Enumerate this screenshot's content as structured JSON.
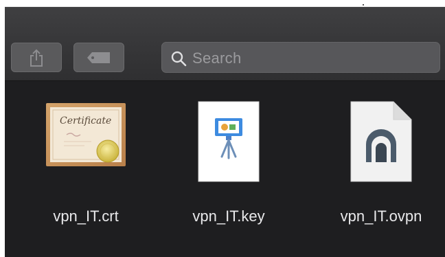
{
  "toolbar": {
    "share_icon": "share-icon",
    "tag_icon": "tag-icon"
  },
  "search": {
    "placeholder": "Search",
    "icon": "magnifier-icon"
  },
  "files": [
    {
      "name": "vpn_IT.crt",
      "icon": "certificate-icon"
    },
    {
      "name": "vpn_IT.key",
      "icon": "keynote-document-icon"
    },
    {
      "name": "vpn_IT.ovpn",
      "icon": "tunnel-document-icon"
    }
  ],
  "certificate_text": "Certificate",
  "colors": {
    "window_bg": "#1e1e20",
    "toolbar": "#3a3a3c",
    "button": "#5a5a5c",
    "text": "#e9e9eb",
    "placeholder": "#9b9b9e"
  }
}
